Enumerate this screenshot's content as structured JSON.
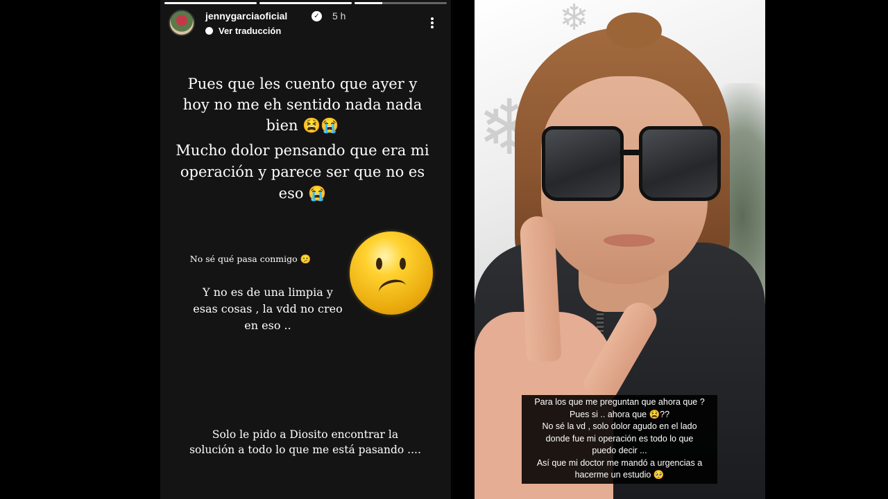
{
  "story_left": {
    "header": {
      "username": "jennygarciaoficial",
      "verified_icon": "verified-badge-icon",
      "time": "5 h",
      "translate_label": "Ver traducción",
      "more_icon": "more-options-icon"
    },
    "progress": [
      1,
      1,
      0.3
    ],
    "text_block_1": "Pues que les cuento que ayer y hoy no me eh sentido nada nada bien 😫😭",
    "text_block_2": "Mucho dolor pensando que era mi operación y parece ser que no es eso 😭",
    "text_small": "No sé qué pasa conmigo 🫤",
    "text_block_3": "Y no es de una limpia y esas cosas , la vdd no creo en eso ..",
    "big_emoji": "confused-face-emoji",
    "text_block_4": "Solo le pido a Diosito encontrar la solución a todo lo que me está pasando ...."
  },
  "story_right": {
    "caption_lines": [
      "Para los que me preguntan que ahora que ?",
      "Pues si .. ahora que 😫??",
      "No sé la vd , solo dolor agudo en el lado",
      "donde fue mi operación es todo lo que",
      "puedo decir ...",
      "Así que mi doctor me mandó a urgencias a",
      "hacerme un estudio 🥺"
    ]
  }
}
